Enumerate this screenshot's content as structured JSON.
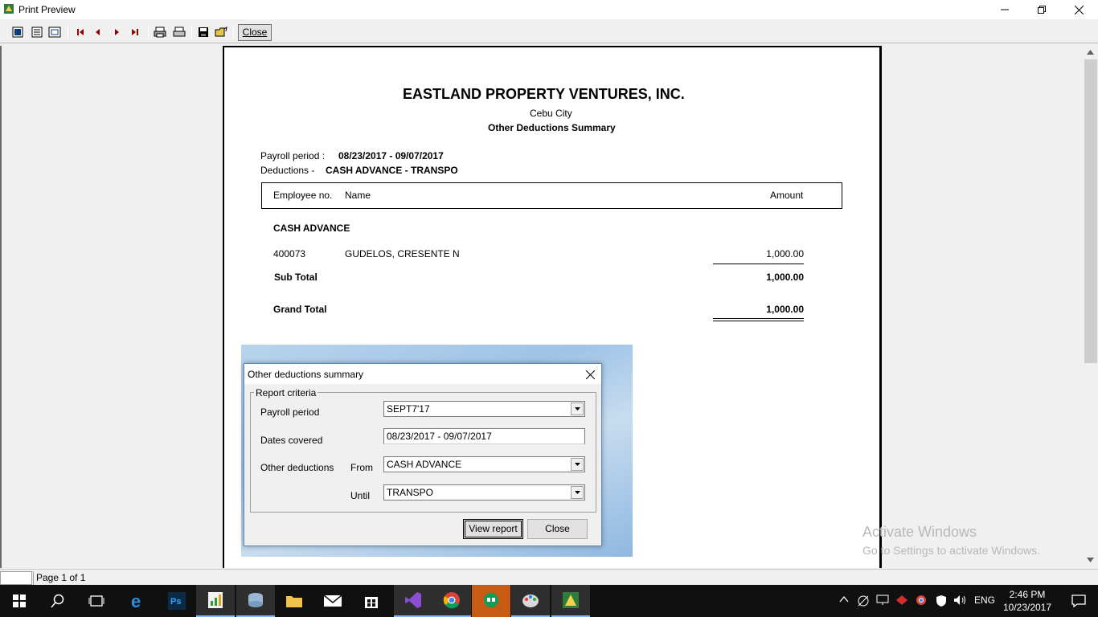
{
  "window": {
    "title": "Print Preview"
  },
  "toolbar": {
    "close_label": "Close",
    "icons": [
      "one-page-icon",
      "page-width-icon",
      "fit-page-icon",
      "first-page-icon",
      "prev-page-icon",
      "next-page-icon",
      "last-page-icon",
      "print-setup-icon",
      "print-icon",
      "save-icon",
      "open-icon"
    ]
  },
  "report": {
    "company": "EASTLAND PROPERTY VENTURES, INC.",
    "city": "Cebu City",
    "subtitle": "Other Deductions Summary",
    "payroll_period_label": "Payroll period :",
    "payroll_period_value": "08/23/2017 - 09/07/2017",
    "deductions_label": "Deductions -",
    "deductions_value": "CASH ADVANCE - TRANSPO",
    "columns": {
      "employee_no": "Employee no.",
      "name": "Name",
      "amount": "Amount"
    },
    "group_title": "CASH ADVANCE",
    "rows": [
      {
        "employee_no": "400073",
        "name": "GUDELOS, CRESENTE N",
        "amount": "1,000.00"
      }
    ],
    "subtotal_label": "Sub Total",
    "subtotal_value": "1,000.00",
    "grandtotal_label": "Grand Total",
    "grandtotal_value": "1,000.00"
  },
  "dialog": {
    "title": "Other deductions summary",
    "group_label": "Report criteria",
    "payroll_period_label": "Payroll period",
    "payroll_period_value": "SEPT7'17",
    "dates_covered_label": "Dates covered",
    "dates_covered_value": "08/23/2017 - 09/07/2017",
    "other_deductions_label": "Other deductions",
    "from_label": "From",
    "from_value": "CASH ADVANCE",
    "until_label": "Until",
    "until_value": "TRANSPO",
    "view_report_label": "View report",
    "close_label": "Close"
  },
  "status": {
    "page": "Page 1 of 1"
  },
  "watermark": {
    "line1": "Activate Windows",
    "line2": "Go to Settings to activate Windows."
  },
  "tray": {
    "lang": "ENG",
    "time": "2:46 PM",
    "date": "10/23/2017"
  }
}
